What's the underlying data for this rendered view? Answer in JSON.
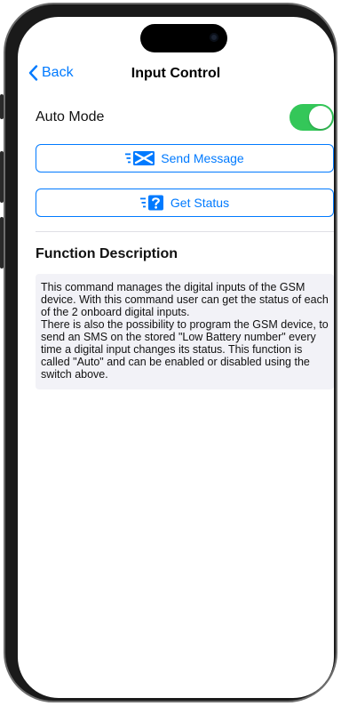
{
  "nav": {
    "back_label": "Back",
    "title": "Input Control"
  },
  "auto_mode": {
    "label": "Auto Mode",
    "enabled": true
  },
  "actions": {
    "send_message_label": "Send Message",
    "get_status_label": "Get Status"
  },
  "description": {
    "title": "Function Description",
    "paragraph_1": "This command manages the digital inputs of the GSM device. With this command user can get the status of each of the 2 onboard digital inputs.",
    "paragraph_2": "There is also the possibility to program the GSM device, to send an SMS on the stored \"Low Battery number\" every time a digital input changes its status. This function is called \"Auto\" and can be enabled or disabled using the switch above."
  },
  "colors": {
    "accent": "#007aff",
    "toggle_on": "#34c759",
    "description_background": "#f2f2f7"
  },
  "icons": {
    "back": "chevron-left-icon",
    "send_message": "envelope-x-icon",
    "get_status": "question-badge-icon"
  }
}
